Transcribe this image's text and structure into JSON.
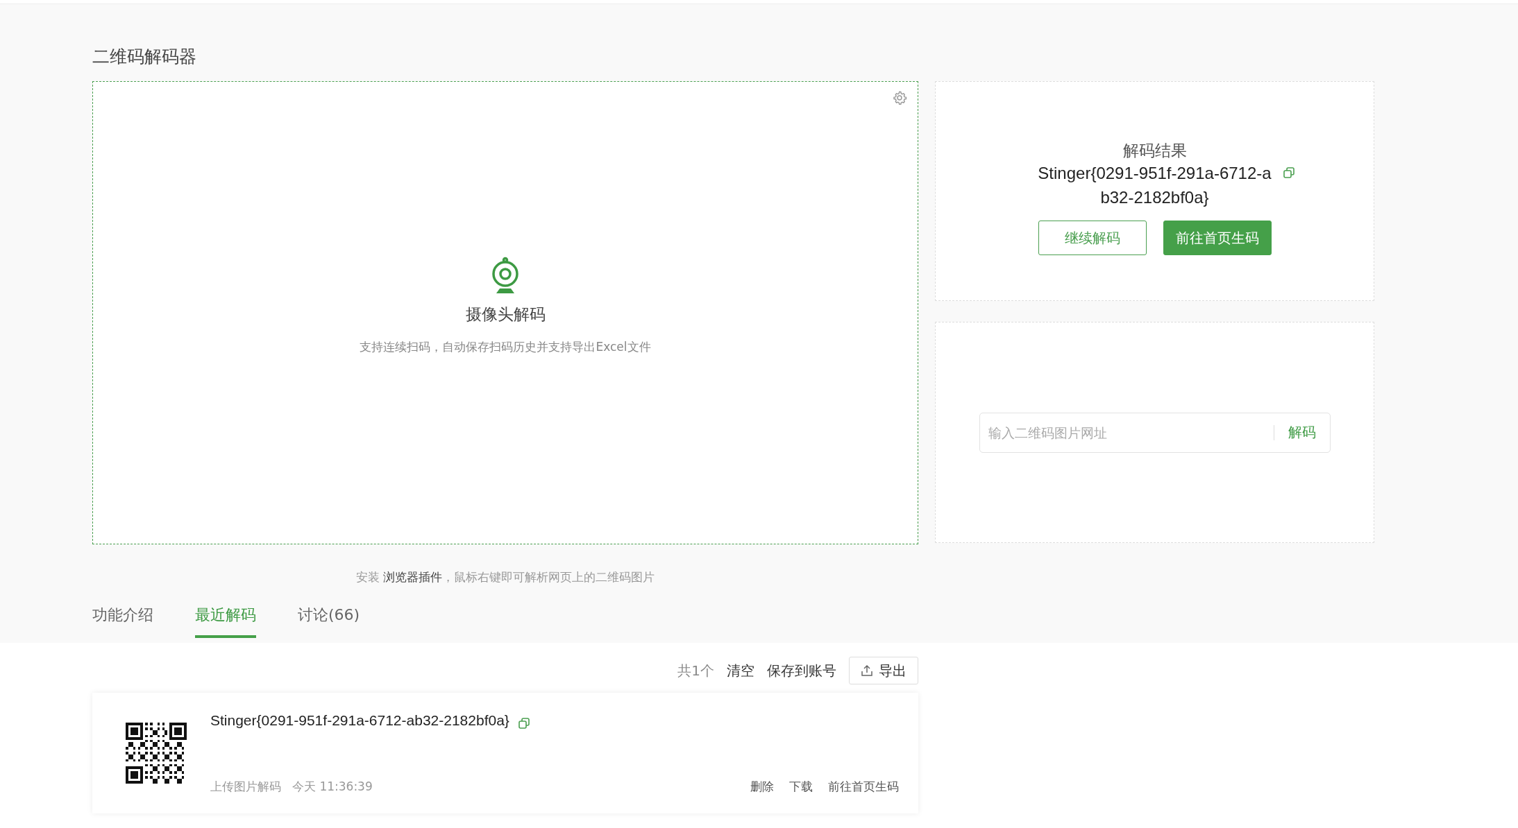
{
  "page_title": "二维码解码器",
  "camera": {
    "title": "摄像头解码",
    "description": "支持连续扫码，自动保存扫码历史并支持导出Excel文件"
  },
  "result": {
    "heading": "解码结果",
    "text": "Stinger{0291-951f-291a-6712-ab32-2182bf0a}",
    "buttons": [
      {
        "label": "继续解码",
        "kind": "outline"
      },
      {
        "label": "前往首页生码",
        "kind": "primary"
      }
    ]
  },
  "url_input": {
    "placeholder": "输入二维码图片网址",
    "button": "解码"
  },
  "plugin_hint": {
    "prefix": "安装",
    "link": "浏览器插件",
    "suffix": "，鼠标右键即可解析网页上的二维码图片"
  },
  "tabs": [
    {
      "label": "功能介绍",
      "selected": false
    },
    {
      "label": "最近解码",
      "selected": true
    },
    {
      "label": "讨论(66)",
      "selected": false
    }
  ],
  "history_toolbar": {
    "count": "共1个",
    "actions": [
      "清空",
      "保存到账号"
    ],
    "export": "导出"
  },
  "history": [
    {
      "text": "Stinger{0291-951f-291a-6712-ab32-2182bf0a}",
      "source": "上传图片解码",
      "time": "今天 11:36:39",
      "actions": [
        "删除",
        "下载",
        "前往首页生码"
      ]
    }
  ]
}
